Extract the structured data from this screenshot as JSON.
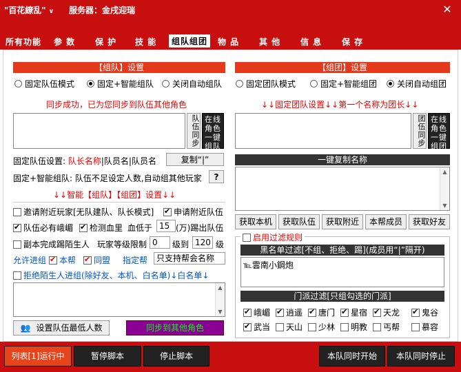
{
  "window": {
    "title": "\"百花繚乱\"",
    "title_caret": "∨",
    "server_label": "服务器：金戌迎瑞",
    "close": "✕"
  },
  "tabs": [
    "所有功能",
    "参 数",
    "保 护",
    "技 能",
    "组队组团",
    "物 品",
    "其 他",
    "信 息",
    "保 存"
  ],
  "left": {
    "header": "【组队】设置",
    "modes": [
      "固定队伍模式",
      "固定+智能组队",
      "关闭自动组队"
    ],
    "sync_msg": "同步成功，已为您同步到队伍其他角色",
    "sync_btn": "队伍同步",
    "online_btn": "在线角色一键组队",
    "fixed_label": "固定队伍设置: ",
    "fixed_red": "队长名称",
    "fixed_rest": "|队员名|队员名",
    "copy_btn": "复制“|”",
    "smart_text": "固定+智能组队: 队伍不足设定人数,自动组其他玩家",
    "q_btn": "?",
    "smart_hdr": "↓↓智能【组队】【组团】设置↓↓",
    "opt1": "邀请附近玩家[无队建队、队长模式]",
    "opt2": "申请附近队伍",
    "opt3": "队伍必有峨嵋",
    "opt4": "检测血里",
    "blood_lbl": "血低于",
    "blood_val": "15",
    "blood_unit": "(万)踢出队伍",
    "opt5": "副本完成踢陌生人",
    "level_lbl": "玩家等级限制",
    "lvl_from": "0",
    "lvl_to_lbl": "级到",
    "lvl_to": "120",
    "lvl_unit": "级",
    "allow_lbl": "允许进组",
    "allow_bb": "本帮",
    "allow_tm": "同盟",
    "assign_lbl": "指定帮",
    "assign_val": "只支持帮会名称",
    "reject_lbl": "拒绝陌生人进组(除好友、本机、白名单)↓白名单↓",
    "set_min_btn": "设置队伍最低人数",
    "sync_other_btn": "同步到其他角色"
  },
  "right": {
    "header": "【组团】设置",
    "modes": [
      "固定团队模式",
      "固定+智能组团",
      "关闭自动组团"
    ],
    "hint": "↓↓固定团队设置↓↓第一个名称为团长↓↓",
    "sync_btn": "团伍同步",
    "online_btn": "在线角色一键组团",
    "copy_hdr": "一键复制名称",
    "btns": [
      "获取本机",
      "获取队伍",
      "获取附近",
      "本帮成员",
      "获取好友"
    ],
    "filter_lbl": "启用过滤规则",
    "blacklist_hdr": "黑名单过滤[不组、拒绝、踢](成员用“|”隔开)",
    "blacklist_val": "℡雲南小鋼炮",
    "sect_hdr": "门派过滤[只组勾选的门派]",
    "sects": [
      {
        "name": "峨嵋",
        "on": true
      },
      {
        "name": "逍遥",
        "on": true
      },
      {
        "name": "唐门",
        "on": true
      },
      {
        "name": "星宿",
        "on": true
      },
      {
        "name": "天龙",
        "on": true
      },
      {
        "name": "鬼谷",
        "on": true
      },
      {
        "name": "武当",
        "on": true
      },
      {
        "name": "天山",
        "on": false
      },
      {
        "name": "少林",
        "on": false
      },
      {
        "name": "明教",
        "on": false
      },
      {
        "name": "丐帮",
        "on": false
      },
      {
        "name": "慕容",
        "on": false
      }
    ]
  },
  "footer": [
    "列表[1]运行中",
    "暂停脚本",
    "停止脚本",
    "本队同时开始",
    "本队同时停止"
  ],
  "colors": {
    "accent": "#c80f0f",
    "header": "#e5391b"
  }
}
